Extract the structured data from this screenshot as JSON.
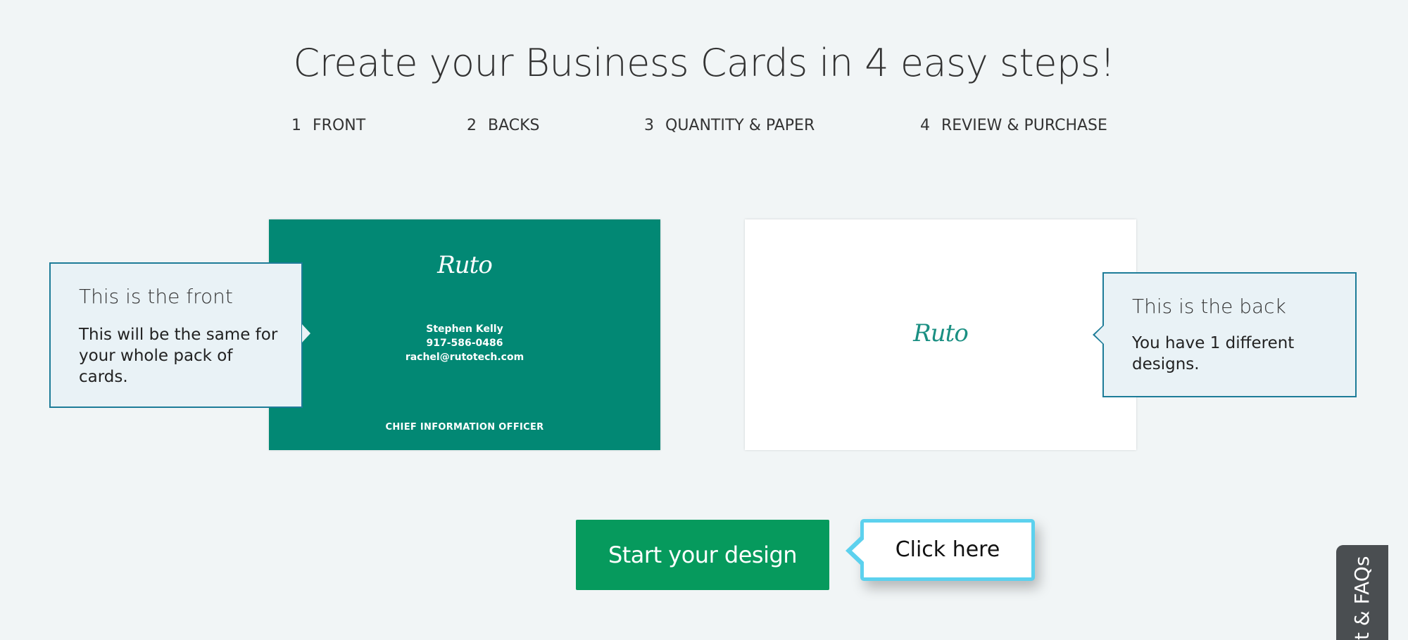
{
  "headline": "Create your Business Cards in 4 easy steps!",
  "steps": [
    {
      "num": "1",
      "label": "FRONT"
    },
    {
      "num": "2",
      "label": "BACKS"
    },
    {
      "num": "3",
      "label": "QUANTITY & PAPER"
    },
    {
      "num": "4",
      "label": "REVIEW & PURCHASE"
    }
  ],
  "front_card": {
    "logo": "Ruto",
    "name": "Stephen Kelly",
    "phone": "917-586-0486",
    "email": "rachel@rutotech.com",
    "job_title": "CHIEF INFORMATION OFFICER",
    "background_color": "#028874"
  },
  "back_card": {
    "logo": "Ruto",
    "background_color": "#ffffff"
  },
  "front_callout": {
    "title": "This is the front",
    "body": "This will be the same for your whole pack of cards."
  },
  "back_callout": {
    "title": "This is the back",
    "body": "You have 1 different designs."
  },
  "start_button": {
    "label": "Start your design",
    "color": "#069a5d"
  },
  "click_tooltip": {
    "label": "Click here"
  },
  "faq_tab": {
    "label": "t & FAQs"
  }
}
